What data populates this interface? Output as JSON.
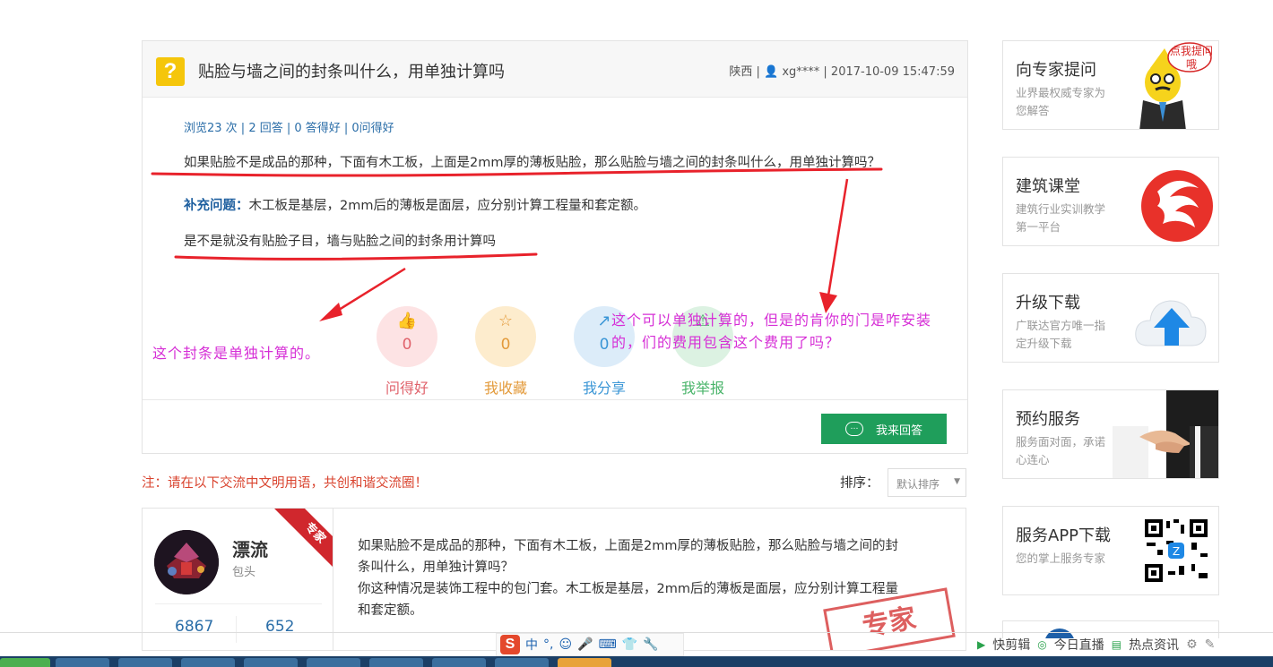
{
  "question": {
    "icon": "question-mark-icon",
    "icon_glyph": "?",
    "title": "贴脸与墙之间的封条叫什么，用单独计算吗",
    "meta": "陕西 | 👤 xg**** | 2017-10-09 15:47:59",
    "stats": "浏览23 次 | 2 回答 | 0 答得好 | 0问得好",
    "body": "如果贴脸不是成品的那种，下面有木工板，上面是2mm厚的薄板贴脸，那么贴脸与墙之间的封条叫什么，用单独计算吗？",
    "supplement_label": "补充问题：",
    "supplement": "木工板是基层，2mm后的薄板是面层，应分别计算工程量和套定额。",
    "supplement2": "是不是就没有贴脸子目，墙与贴脸之间的封条用计算吗"
  },
  "actions": [
    {
      "icon": "thumbs-up-icon",
      "glyph": "👍",
      "count": "0",
      "label": "问得好",
      "color": "#e0626b",
      "bg": "#fde3e4"
    },
    {
      "icon": "star-icon",
      "glyph": "☆",
      "count": "0",
      "label": "我收藏",
      "color": "#e39a3a",
      "bg": "#fdeccd"
    },
    {
      "icon": "share-icon",
      "glyph": "↗",
      "count": "0",
      "label": "我分享",
      "color": "#3a96d6",
      "bg": "#dcecf9"
    },
    {
      "icon": "warning-icon",
      "glyph": "⚠",
      "count": "",
      "label": "我举报",
      "color": "#49b46a",
      "bg": "#dcf2e2"
    }
  ],
  "answer_button": {
    "label": "我来回答",
    "icon": "chat-bubble-icon",
    "glyph": "…"
  },
  "notice": "注：请在以下交流中文明用语，共创和谐交流圈！",
  "sort": {
    "label": "排序：",
    "selected": "默认排序"
  },
  "answer": {
    "name": "漂流",
    "location": "包头",
    "badge": "专家",
    "count1": "6867",
    "count2": "652",
    "text_quote": "如果贴脸不是成品的那种，下面有木工板，上面是2mm厚的薄板贴脸，那么贴脸与墙之间的封条叫什么，用单独计算吗？",
    "text_answer": "你这种情况是装饰工程中的包门套。木工板是基层，2mm后的薄板是面层，应分别计算工程量和套定额。",
    "stamp": "专家"
  },
  "sidebar": [
    {
      "title": "向专家提问",
      "desc": "业界最权威专家为您解答",
      "bubble": "点我提问哦",
      "art": "mascot-icon"
    },
    {
      "title": "建筑课堂",
      "desc": "建筑行业实训教学第一平台",
      "art": "logo-icon"
    },
    {
      "title": "升级下载",
      "desc": "广联达官方唯一指定升级下载",
      "art": "cloud-upload-icon"
    },
    {
      "title": "预约服务",
      "desc": "服务面对面，承诺心连心",
      "art": "handshake-image"
    },
    {
      "title": "服务APP下载",
      "desc": "您的掌上服务专家",
      "art": "qr-code-image"
    }
  ],
  "annotations": {
    "left": "这个封条是单独计算的。",
    "right_line1": "这个可以单独计算的，但是的肯你的门是咋安装",
    "right_line2": "的，们的费用包含这个费用了吗？",
    "color": "#d62fd6",
    "stroke": "#e8222b"
  },
  "ime": {
    "logo": "S",
    "mode": "中",
    "punct": "°,",
    "items": [
      "☺",
      "🎤",
      "⌨",
      "👕",
      "🔧"
    ]
  },
  "browser": {
    "items": [
      "快剪辑",
      "今日直播",
      "热点资讯"
    ]
  }
}
